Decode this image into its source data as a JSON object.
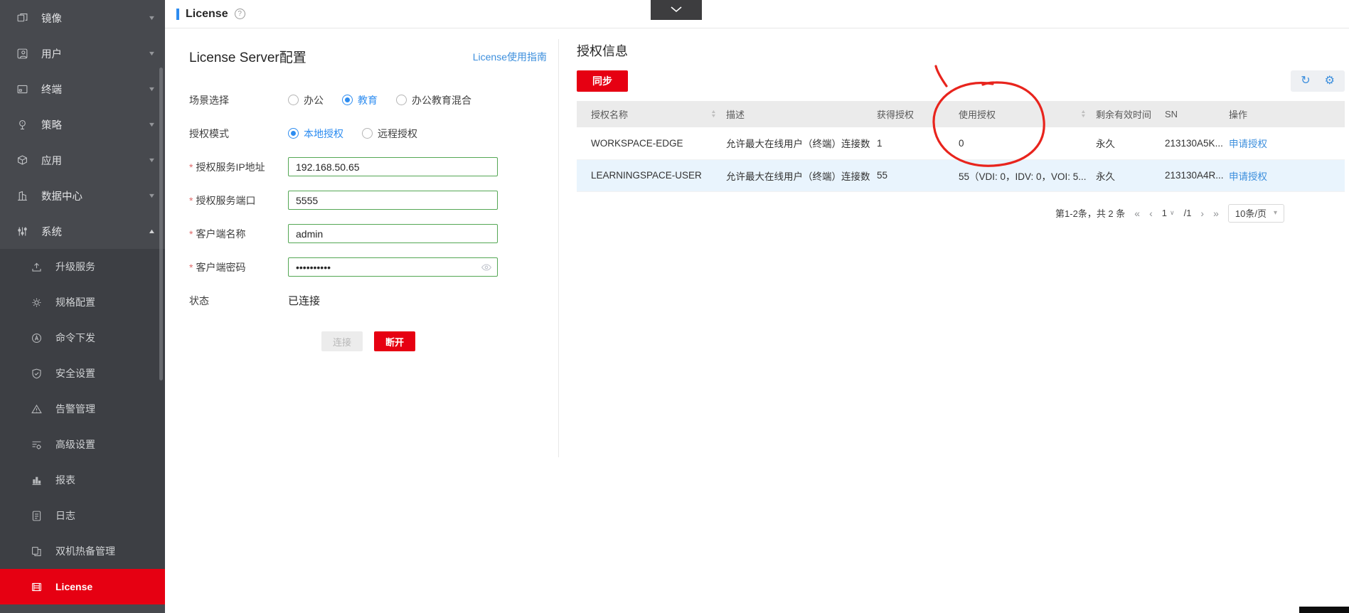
{
  "header": {
    "title": "License"
  },
  "collapse_tab": {
    "purpose": "collapse-panel"
  },
  "icons": {
    "help": "?",
    "sort_up": "▲",
    "sort_down": "▼",
    "refresh": "↻",
    "settings": "⚙",
    "first_page": "«",
    "prev_page": "‹",
    "next_page": "›",
    "last_page": "»",
    "page_caret": "∨",
    "size_caret": "▾",
    "collapse_up": "▲",
    "expand_down": "▼",
    "required_mark": "*"
  },
  "colors": {
    "accent_red": "#e60012",
    "link_blue": "#3d8fdd",
    "selected_blue": "#2d8cf0",
    "input_border_green": "#54a754",
    "row_highlight_blue": "#e9f4fd",
    "annotation_red": "#e8241d"
  },
  "sidebar": {
    "top_items": [
      {
        "label": "镜像"
      },
      {
        "label": "用户"
      },
      {
        "label": "终端"
      },
      {
        "label": "策略"
      },
      {
        "label": "应用"
      },
      {
        "label": "数据中心"
      },
      {
        "label": "系统",
        "expanded": true
      }
    ],
    "sub_items": [
      {
        "label": "升级服务"
      },
      {
        "label": "规格配置"
      },
      {
        "label": "命令下发"
      },
      {
        "label": "安全设置"
      },
      {
        "label": "告警管理"
      },
      {
        "label": "高级设置"
      },
      {
        "label": "报表"
      },
      {
        "label": "日志"
      },
      {
        "label": "双机热备管理"
      },
      {
        "label": "License",
        "active": true
      }
    ]
  },
  "license_config": {
    "title": "License Server配置",
    "guide_link": "License使用指南",
    "scene": {
      "label": "场景选择",
      "options": [
        {
          "label": "办公",
          "selected": false
        },
        {
          "label": "教育",
          "selected": true
        },
        {
          "label": "办公教育混合",
          "selected": false
        }
      ]
    },
    "auth_mode": {
      "label": "授权模式",
      "options": [
        {
          "label": "本地授权",
          "selected": true
        },
        {
          "label": "远程授权",
          "selected": false
        }
      ]
    },
    "inputs": [
      {
        "label": "授权服务IP地址",
        "value": "192.168.50.65",
        "required": true
      },
      {
        "label": "授权服务端口",
        "value": "5555",
        "required": true
      },
      {
        "label": "客户端名称",
        "value": "admin",
        "required": true
      },
      {
        "label": "客户端密码",
        "value": "••••••••••",
        "required": true,
        "type": "password"
      }
    ],
    "status": {
      "label": "状态",
      "value": "已连接"
    },
    "buttons": {
      "connect": "连接",
      "disconnect": "断开"
    }
  },
  "license_info": {
    "title": "授权信息",
    "sync_button": "同步",
    "table": {
      "columns": [
        "授权名称",
        "描述",
        "获得授权",
        "使用授权",
        "剩余有效时间",
        "SN",
        "操作"
      ],
      "rows": [
        {
          "name": "WORKSPACE-EDGE",
          "desc": "允许最大在线用户（终端）连接数",
          "granted": "1",
          "used": "0",
          "valid": "永久",
          "sn": "213130A5K...",
          "action": "申请授权"
        },
        {
          "name": "LEARNINGSPACE-USER",
          "desc": "允许最大在线用户（终端）连接数",
          "granted": "55",
          "used": "55（VDI: 0，IDV: 0，VOI: 5...",
          "valid": "永久",
          "sn": "213130A4R...",
          "action": "申请授权"
        }
      ]
    },
    "pagination": {
      "range_summary": "第1-2条，共 2 条",
      "current_page": "1",
      "total_pages": "/1",
      "page_size": "10条/页"
    }
  }
}
